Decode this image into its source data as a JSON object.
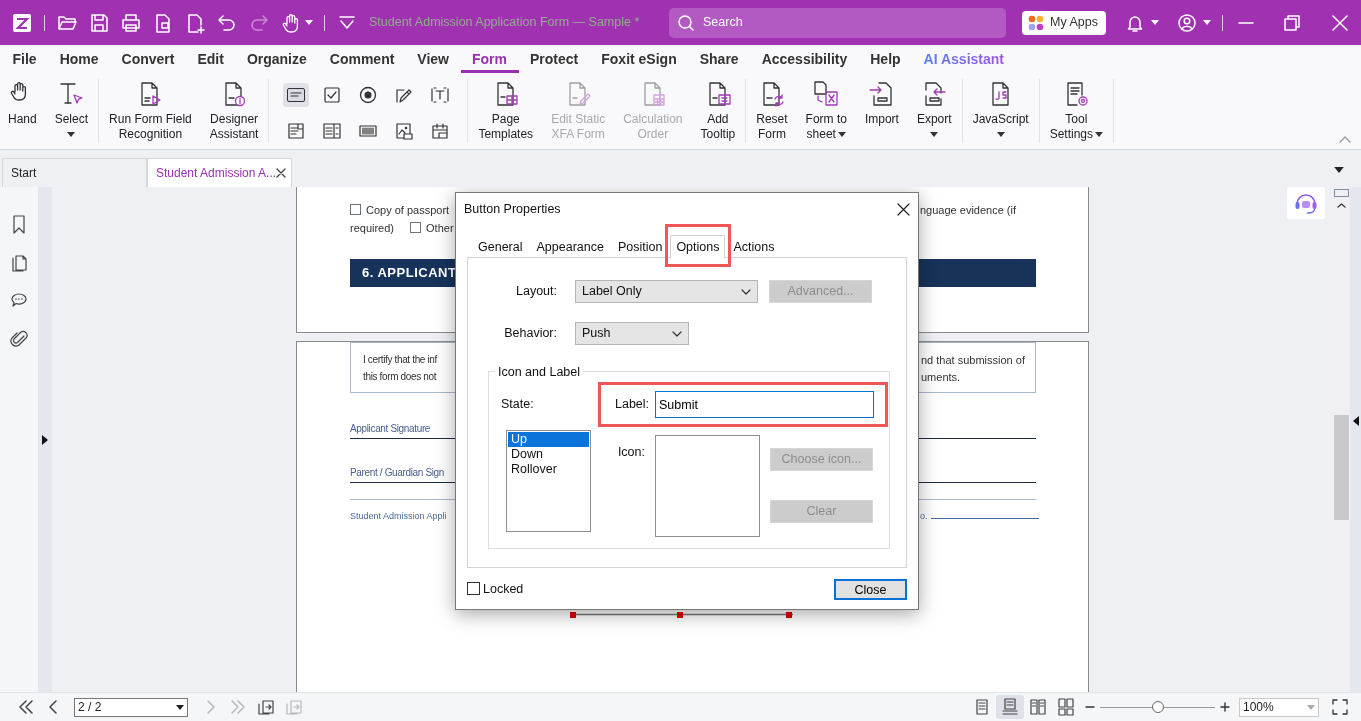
{
  "title_bar": {
    "quick_tools": [
      {
        "kind": "logo",
        "disabled": false
      },
      {
        "kind": "open",
        "disabled": false
      },
      {
        "kind": "save",
        "disabled": false
      },
      {
        "kind": "print",
        "disabled": false
      },
      {
        "kind": "page",
        "disabled": false
      },
      {
        "kind": "new",
        "disabled": false
      },
      {
        "kind": "undo",
        "disabled": false
      },
      {
        "kind": "redo",
        "disabled": true
      },
      {
        "kind": "hand",
        "disabled": false
      },
      {
        "kind": "customize",
        "disabled": false
      }
    ],
    "title": "Student Admission Application Form — Sample *",
    "search": {
      "placeholder": "Search"
    },
    "apps_button": "My Apps"
  },
  "menu": [
    {
      "label": "File",
      "kind": "menu",
      "selected": false
    },
    {
      "label": "Home",
      "kind": "menu",
      "selected": false
    },
    {
      "label": "Convert",
      "kind": "menu",
      "selected": false
    },
    {
      "label": "Edit",
      "kind": "menu",
      "selected": false
    },
    {
      "label": "Organize",
      "kind": "menu",
      "selected": false
    },
    {
      "label": "Comment",
      "kind": "menu",
      "selected": false
    },
    {
      "label": "View",
      "kind": "menu",
      "selected": false
    },
    {
      "label": "Form",
      "kind": "menu",
      "selected": true
    },
    {
      "label": "Protect",
      "kind": "menu",
      "selected": false
    },
    {
      "label": "Foxit eSign",
      "kind": "menu",
      "selected": false
    },
    {
      "label": "Share",
      "kind": "menu",
      "selected": false
    },
    {
      "label": "Accessibility",
      "kind": "menu",
      "selected": false
    },
    {
      "label": "Help",
      "kind": "menu",
      "selected": false
    },
    {
      "label": "AI Assistant",
      "kind": "ai",
      "selected": false
    }
  ],
  "ribbon": [
    {
      "kind": "buttons",
      "items": [
        {
          "label": "Hand",
          "kind": "hand",
          "disabled": false,
          "dropdown": false
        },
        {
          "label": "Select",
          "kind": "select",
          "disabled": false,
          "dropdown": true
        }
      ]
    },
    {
      "kind": "buttons",
      "items": [
        {
          "label": "Run Form Field\nRecognition",
          "kind": "run",
          "disabled": false,
          "dropdown": false
        },
        {
          "label": "Designer\nAssistant",
          "kind": "designer",
          "disabled": false,
          "dropdown": false
        }
      ]
    },
    {
      "kind": "form_tools",
      "items": [
        {
          "kind": "button",
          "selected": true
        },
        {
          "kind": "checkbox",
          "selected": false
        },
        {
          "kind": "radio",
          "selected": false
        },
        {
          "kind": "signature",
          "selected": false
        },
        {
          "kind": "text",
          "selected": false
        },
        {
          "kind": "list",
          "selected": false
        },
        {
          "kind": "listbox",
          "selected": false
        },
        {
          "kind": "barcode",
          "selected": false
        },
        {
          "kind": "image",
          "selected": false
        },
        {
          "kind": "date",
          "selected": false
        }
      ]
    },
    {
      "kind": "buttons",
      "items": [
        {
          "label": "Page\nTemplates",
          "kind": "templates",
          "disabled": false,
          "dropdown": false
        },
        {
          "label": "Edit Static\nXFA Form",
          "kind": "edit",
          "disabled": true,
          "dropdown": false
        },
        {
          "label": "Calculation\nOrder",
          "kind": "calc",
          "disabled": true,
          "dropdown": false
        },
        {
          "label": "Add\nTooltip",
          "kind": "tooltip",
          "disabled": false,
          "dropdown": false
        }
      ]
    },
    {
      "kind": "buttons",
      "items": [
        {
          "label": "Reset\nForm",
          "kind": "reset",
          "disabled": false,
          "dropdown": false
        },
        {
          "label": "Form to\nsheet",
          "kind": "sheet",
          "disabled": false,
          "dropdown": true
        },
        {
          "label": "Import",
          "kind": "import",
          "disabled": false,
          "dropdown": false
        },
        {
          "label": "Export",
          "kind": "export",
          "disabled": false,
          "dropdown": true
        }
      ]
    },
    {
      "kind": "buttons",
      "items": [
        {
          "label": "JavaScript",
          "kind": "js",
          "disabled": false,
          "dropdown": true
        }
      ]
    },
    {
      "kind": "buttons",
      "items": [
        {
          "label": "Tool\nSettings",
          "kind": "settings",
          "disabled": false,
          "dropdown": true
        }
      ]
    }
  ],
  "doc_tabs": [
    {
      "label": "Start",
      "selected": false,
      "closable": false
    },
    {
      "label": "Student Admission A...",
      "selected": true,
      "closable": true
    }
  ],
  "document": {
    "checklist": [
      {
        "label": "Copy of passport",
        "checked": false
      },
      {
        "label": "Other",
        "checked": false
      }
    ],
    "wrap_text": "required)",
    "right_text": "nguage evidence (if",
    "section_heading": "6. APPLICANT",
    "certification_left": [
      "I certify that the inf",
      "this form does not"
    ],
    "certification_right": [
      "nd that submission of",
      "uments."
    ],
    "signature_fields": [
      "Applicant Signature",
      "Parent / Guardian Sign"
    ],
    "footer_left": "Student Admission Appli",
    "footer_right": "o."
  },
  "dialog": {
    "title": "Button Properties",
    "tabs": [
      {
        "label": "General",
        "selected": false,
        "highlighted": false
      },
      {
        "label": "Appearance",
        "selected": false,
        "highlighted": false
      },
      {
        "label": "Position",
        "selected": false,
        "highlighted": false
      },
      {
        "label": "Options",
        "selected": true,
        "highlighted": true
      },
      {
        "label": "Actions",
        "selected": false,
        "highlighted": false
      }
    ],
    "layout": {
      "label": "Layout:",
      "value": "Label Only"
    },
    "advanced_button": {
      "label": "Advanced...",
      "disabled": true
    },
    "behavior": {
      "label": "Behavior:",
      "value": "Push"
    },
    "group_title": "Icon and Label",
    "state_label": "State:",
    "states": [
      {
        "label": "Up",
        "selected": true
      },
      {
        "label": "Down",
        "selected": false
      },
      {
        "label": "Rollover",
        "selected": false
      }
    ],
    "label_field": {
      "label": "Label:",
      "value": "Submit",
      "highlighted": true
    },
    "icon_label": "Icon:",
    "icon_buttons": [
      {
        "label": "Choose icon...",
        "disabled": true
      },
      {
        "label": "Clear",
        "disabled": true
      }
    ],
    "locked": {
      "label": "Locked",
      "checked": false
    },
    "close_button": "Close"
  },
  "status_bar": {
    "nav": [
      {
        "kind": "first",
        "disabled": false
      },
      {
        "kind": "prev",
        "disabled": false
      }
    ],
    "page": "2 / 2",
    "nav_end": [
      {
        "kind": "next",
        "disabled": true
      },
      {
        "kind": "last",
        "disabled": true
      },
      {
        "kind": "back_view",
        "disabled": false
      },
      {
        "kind": "forward_view",
        "disabled": true
      }
    ],
    "view_modes": [
      {
        "kind": "single",
        "selected": false
      },
      {
        "kind": "continuous",
        "selected": true
      },
      {
        "kind": "facing",
        "selected": false
      },
      {
        "kind": "continuous_facing",
        "selected": false
      }
    ],
    "zoom": {
      "level": 0.5,
      "value": "100%"
    }
  }
}
